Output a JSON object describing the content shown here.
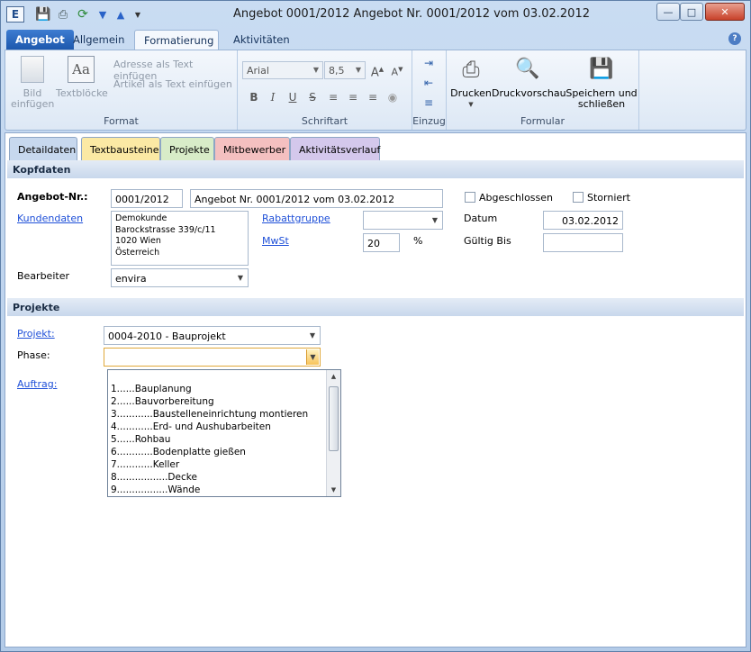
{
  "window": {
    "title": "Angebot 0001/2012 Angebot Nr. 0001/2012 vom 03.02.2012",
    "app_icon": "E"
  },
  "ribbon_tabs": [
    "Angebot",
    "Allgemein",
    "Formatierung",
    "Aktivitäten"
  ],
  "ribbon": {
    "format": {
      "label": "Format",
      "bild": "Bild einfügen",
      "textbloecke": "Textblöcke",
      "adresse": "Adresse als Text einfügen",
      "artikel": "Artikel als Text einfügen"
    },
    "schriftart": {
      "label": "Schriftart",
      "font": "Arial",
      "size": "8,5",
      "buttons": [
        "B",
        "I",
        "U",
        "S"
      ]
    },
    "einzug": {
      "label": "Einzug"
    },
    "formular": {
      "label": "Formular",
      "drucken": "Drucken",
      "druckvorschau": "Druckvorschau",
      "speichern": "Speichern und schließen"
    }
  },
  "doc_tabs": [
    {
      "label": "Detaildaten",
      "color": "#c7d8ee"
    },
    {
      "label": "Textbausteine",
      "color": "#fbe9a4"
    },
    {
      "label": "Projekte",
      "color": "#d8ecc8"
    },
    {
      "label": "Mitbewerber",
      "color": "#f4c0c0"
    },
    {
      "label": "Aktivitätsverlauf",
      "color": "#d4c8ec"
    }
  ],
  "kopfdaten": {
    "section": "Kopfdaten",
    "angebot_nr_label": "Angebot-Nr.:",
    "angebot_nr": "0001/2012",
    "angebot_title": "Angebot Nr. 0001/2012 vom 03.02.2012",
    "abgeschlossen": "Abgeschlossen",
    "storniert": "Storniert",
    "kundendaten_label": "Kundendaten",
    "address_lines": [
      "Demokunde",
      "Barockstrasse 339/c/11",
      "1020 Wien",
      "Österreich"
    ],
    "rabattgruppe_label": "Rabattgruppe",
    "rabattgruppe": "",
    "mwst_label": "MwSt",
    "mwst": "20",
    "percent": "%",
    "datum_label": "Datum",
    "datum": "03.02.2012",
    "gueltig_label": "Gültig Bis",
    "gueltig": "",
    "bearbeiter_label": "Bearbeiter",
    "bearbeiter": "envira"
  },
  "projekte": {
    "section": "Projekte",
    "projekt_label": "Projekt:",
    "projekt": "0004-2010 - Bauprojekt",
    "phase_label": "Phase:",
    "phase": "",
    "auftrag_label": "Auftrag:",
    "phase_options": [
      "1......Bauplanung",
      "2......Bauvorbereitung",
      "3............Baustelleneinrichtung montieren",
      "4............Erd- und Aushubarbeiten",
      "5......Rohbau",
      "6............Bodenplatte gießen",
      "7............Keller",
      "8.................Decke",
      "9.................Wände"
    ]
  }
}
